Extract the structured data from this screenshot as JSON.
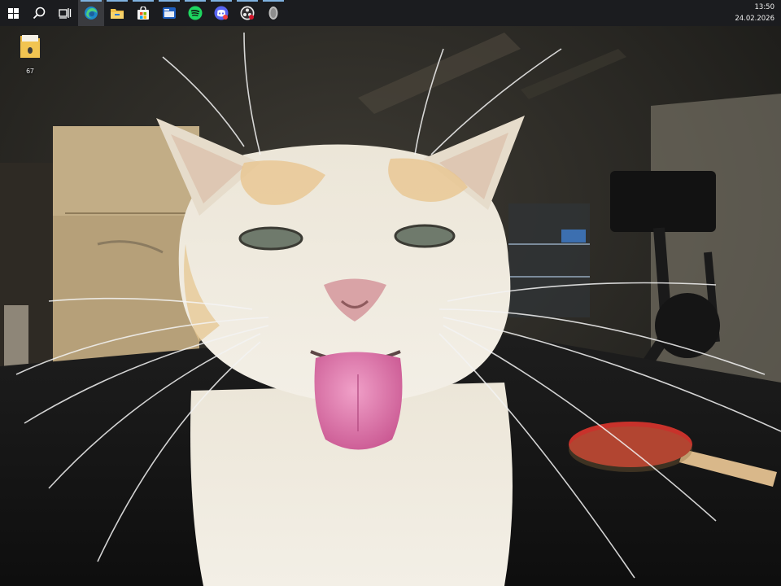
{
  "taskbar": {
    "items": [
      {
        "id": "start",
        "icon": "windows-logo-icon",
        "running": false
      },
      {
        "id": "search",
        "icon": "search-icon",
        "running": false
      },
      {
        "id": "taskview",
        "icon": "task-view-icon",
        "running": false
      },
      {
        "id": "edge",
        "icon": "edge-browser-icon",
        "running": true,
        "active": true
      },
      {
        "id": "explorer",
        "icon": "file-explorer-icon",
        "running": true
      },
      {
        "id": "store",
        "icon": "microsoft-store-icon",
        "running": true
      },
      {
        "id": "files",
        "icon": "files-app-icon",
        "running": true
      },
      {
        "id": "spotify",
        "icon": "spotify-icon",
        "running": true
      },
      {
        "id": "discord",
        "icon": "discord-icon",
        "running": true
      },
      {
        "id": "obs",
        "icon": "obs-icon",
        "running": true
      },
      {
        "id": "misc",
        "icon": "app-icon",
        "running": true
      }
    ],
    "clock": {
      "time": "13:50",
      "date": "24.02.2026"
    }
  },
  "desktop": {
    "icons": [
      {
        "label": "67",
        "icon": "folder-icon"
      }
    ]
  },
  "colors": {
    "taskbar_bg": "#1b1c1f",
    "running_indicator": "#7fb2e0",
    "active_bg": "#3a3b3f"
  }
}
